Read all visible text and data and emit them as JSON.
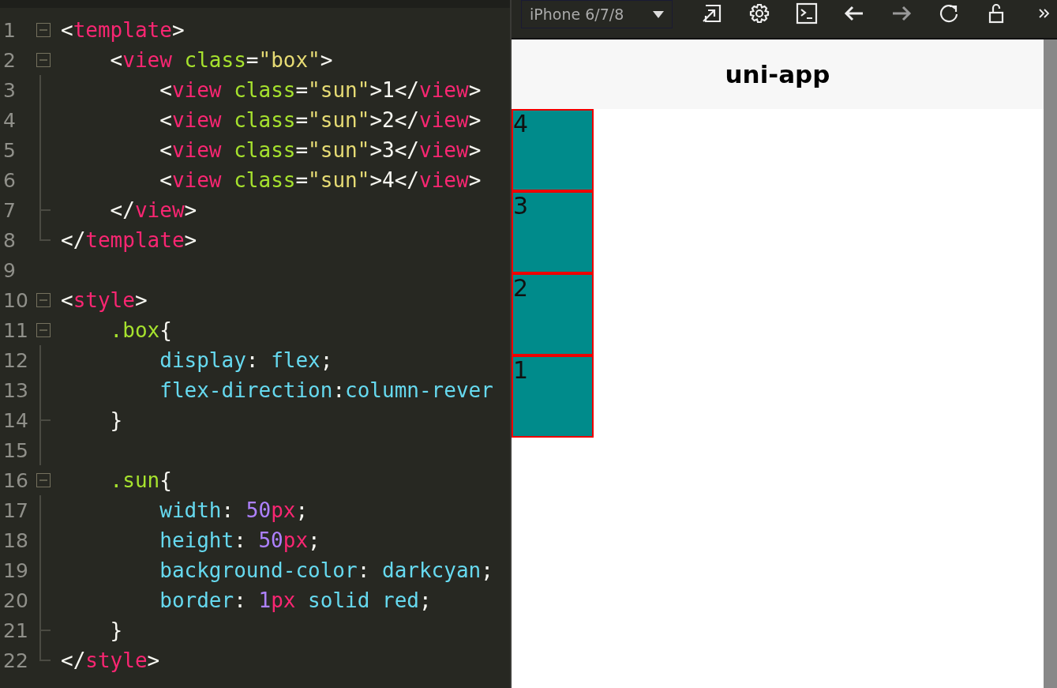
{
  "editor": {
    "lines": [
      {
        "number": "1",
        "kind": "open",
        "tokens": [
          {
            "t": "<",
            "kind": "p"
          },
          {
            "t": "template",
            "kind": "tag"
          },
          {
            "t": ">",
            "kind": "p"
          }
        ]
      },
      {
        "number": "2",
        "kind": "open",
        "tokens": [
          {
            "t": "    <",
            "kind": "p"
          },
          {
            "t": "view",
            "kind": "tag"
          },
          {
            "t": " class",
            "kind": "attr"
          },
          {
            "t": "=",
            "kind": "p"
          },
          {
            "t": "\"box\"",
            "kind": "str"
          },
          {
            "t": ">",
            "kind": "p"
          }
        ]
      },
      {
        "number": "3",
        "kind": "line",
        "tokens": [
          {
            "t": "        <",
            "kind": "p"
          },
          {
            "t": "view",
            "kind": "tag"
          },
          {
            "t": " class",
            "kind": "attr"
          },
          {
            "t": "=",
            "kind": "p"
          },
          {
            "t": "\"sun\"",
            "kind": "str"
          },
          {
            "t": ">1</",
            "kind": "p"
          },
          {
            "t": "view",
            "kind": "tag"
          },
          {
            "t": ">",
            "kind": "p"
          }
        ]
      },
      {
        "number": "4",
        "kind": "line",
        "tokens": [
          {
            "t": "        <",
            "kind": "p"
          },
          {
            "t": "view",
            "kind": "tag"
          },
          {
            "t": " class",
            "kind": "attr"
          },
          {
            "t": "=",
            "kind": "p"
          },
          {
            "t": "\"sun\"",
            "kind": "str"
          },
          {
            "t": ">2</",
            "kind": "p"
          },
          {
            "t": "view",
            "kind": "tag"
          },
          {
            "t": ">",
            "kind": "p"
          }
        ]
      },
      {
        "number": "5",
        "kind": "line",
        "tokens": [
          {
            "t": "        <",
            "kind": "p"
          },
          {
            "t": "view",
            "kind": "tag"
          },
          {
            "t": " class",
            "kind": "attr"
          },
          {
            "t": "=",
            "kind": "p"
          },
          {
            "t": "\"sun\"",
            "kind": "str"
          },
          {
            "t": ">3</",
            "kind": "p"
          },
          {
            "t": "view",
            "kind": "tag"
          },
          {
            "t": ">",
            "kind": "p"
          }
        ]
      },
      {
        "number": "6",
        "kind": "line",
        "tokens": [
          {
            "t": "        <",
            "kind": "p"
          },
          {
            "t": "view",
            "kind": "tag"
          },
          {
            "t": " class",
            "kind": "attr"
          },
          {
            "t": "=",
            "kind": "p"
          },
          {
            "t": "\"sun\"",
            "kind": "str"
          },
          {
            "t": ">4</",
            "kind": "p"
          },
          {
            "t": "view",
            "kind": "tag"
          },
          {
            "t": ">",
            "kind": "p"
          }
        ]
      },
      {
        "number": "7",
        "kind": "tick",
        "tokens": [
          {
            "t": "    </",
            "kind": "p"
          },
          {
            "t": "view",
            "kind": "tag"
          },
          {
            "t": ">",
            "kind": "p"
          }
        ]
      },
      {
        "number": "8",
        "kind": "end",
        "tokens": [
          {
            "t": "</",
            "kind": "p"
          },
          {
            "t": "template",
            "kind": "tag"
          },
          {
            "t": ">",
            "kind": "p"
          }
        ]
      },
      {
        "number": "9",
        "kind": "none"
      },
      {
        "number": "10",
        "kind": "open",
        "tokens": [
          {
            "t": "<",
            "kind": "p"
          },
          {
            "t": "style",
            "kind": "tag"
          },
          {
            "t": ">",
            "kind": "p"
          }
        ]
      },
      {
        "number": "11",
        "kind": "open",
        "tokens": [
          {
            "t": "    .box",
            "kind": "attr"
          },
          {
            "t": "{",
            "kind": "p"
          }
        ]
      },
      {
        "number": "12",
        "kind": "line",
        "tokens": [
          {
            "t": "        display",
            "kind": "prop"
          },
          {
            "t": ": ",
            "kind": "p"
          },
          {
            "t": "flex",
            "kind": "prop"
          },
          {
            "t": ";",
            "kind": "p"
          }
        ]
      },
      {
        "number": "13",
        "kind": "line",
        "tokens": [
          {
            "t": "        flex-direction",
            "kind": "prop"
          },
          {
            "t": ":",
            "kind": "p"
          },
          {
            "t": "column-rever",
            "kind": "prop"
          }
        ]
      },
      {
        "number": "14",
        "kind": "tick",
        "tokens": [
          {
            "t": "    }",
            "kind": "p"
          }
        ]
      },
      {
        "number": "15",
        "kind": "line"
      },
      {
        "number": "16",
        "kind": "open",
        "tokens": [
          {
            "t": "    .sun",
            "kind": "attr"
          },
          {
            "t": "{",
            "kind": "p"
          }
        ]
      },
      {
        "number": "17",
        "kind": "line",
        "tokens": [
          {
            "t": "        width",
            "kind": "prop"
          },
          {
            "t": ": ",
            "kind": "p"
          },
          {
            "t": "50",
            "kind": "num"
          },
          {
            "t": "px",
            "kind": "tag"
          },
          {
            "t": ";",
            "kind": "p"
          }
        ]
      },
      {
        "number": "18",
        "kind": "line",
        "tokens": [
          {
            "t": "        height",
            "kind": "prop"
          },
          {
            "t": ": ",
            "kind": "p"
          },
          {
            "t": "50",
            "kind": "num"
          },
          {
            "t": "px",
            "kind": "tag"
          },
          {
            "t": ";",
            "kind": "p"
          }
        ]
      },
      {
        "number": "19",
        "kind": "line",
        "tokens": [
          {
            "t": "        background-color",
            "kind": "prop"
          },
          {
            "t": ": ",
            "kind": "p"
          },
          {
            "t": "darkcyan",
            "kind": "prop"
          },
          {
            "t": ";",
            "kind": "p"
          }
        ]
      },
      {
        "number": "20",
        "kind": "line",
        "tokens": [
          {
            "t": "        border",
            "kind": "prop"
          },
          {
            "t": ": ",
            "kind": "p"
          },
          {
            "t": "1",
            "kind": "num"
          },
          {
            "t": "px",
            "kind": "tag"
          },
          {
            "t": " solid red",
            "kind": "prop"
          },
          {
            "t": ";",
            "kind": "p"
          }
        ]
      },
      {
        "number": "21",
        "kind": "tick",
        "tokens": [
          {
            "t": "    }",
            "kind": "p"
          }
        ]
      },
      {
        "number": "22",
        "kind": "end",
        "tokens": [
          {
            "t": "</",
            "kind": "p"
          },
          {
            "t": "style",
            "kind": "tag"
          },
          {
            "t": ">",
            "kind": "p"
          }
        ]
      }
    ]
  },
  "preview": {
    "device": "iPhone 6/7/8",
    "toolbar": [
      {
        "kind": "popout"
      },
      {
        "kind": "settings"
      },
      {
        "kind": "console"
      },
      {
        "kind": "back"
      },
      {
        "kind": "forward"
      },
      {
        "kind": "reload"
      },
      {
        "kind": "lock"
      },
      {
        "kind": "more"
      }
    ],
    "nav_title": "uni-app",
    "boxes": [
      "4",
      "3",
      "2",
      "1"
    ]
  }
}
